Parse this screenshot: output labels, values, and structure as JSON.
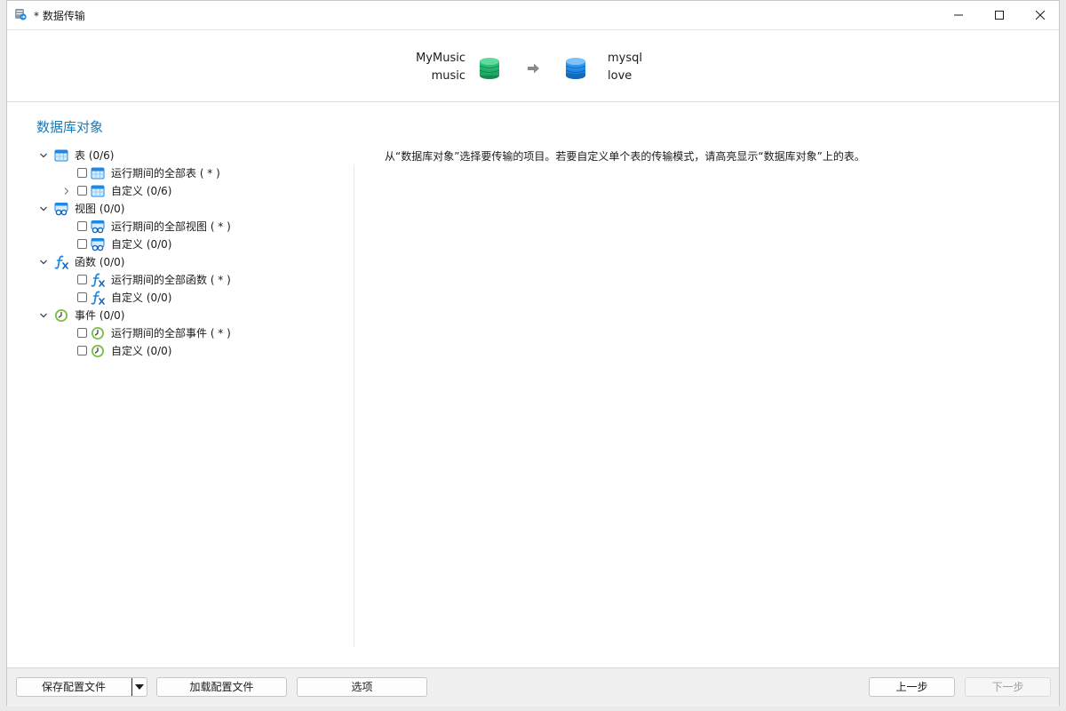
{
  "window": {
    "title": "* 数据传输"
  },
  "header": {
    "source": {
      "connection": "MyMusic",
      "database": "music"
    },
    "target": {
      "connection": "mysql",
      "database": "love"
    }
  },
  "section_title": "数据库对象",
  "tree": {
    "tables": {
      "label": "表 (0/6)",
      "all": "运行期间的全部表 ( * )",
      "custom": "自定义 (0/6)"
    },
    "views": {
      "label": "视图 (0/0)",
      "all": "运行期间的全部视图 ( * )",
      "custom": "自定义 (0/0)"
    },
    "functions": {
      "label": "函数 (0/0)",
      "all": "运行期间的全部函数 ( * )",
      "custom": "自定义 (0/0)"
    },
    "events": {
      "label": "事件 (0/0)",
      "all": "运行期间的全部事件 ( * )",
      "custom": "自定义 (0/0)"
    }
  },
  "hint": "从“数据库对象”选择要传输的项目。若要自定义单个表的传输模式，请高亮显示“数据库对象”上的表。",
  "footer": {
    "save_profile": "保存配置文件",
    "load_profile": "加载配置文件",
    "options": "选项",
    "back": "上一步",
    "next": "下一步"
  },
  "colors": {
    "accent": "#1a7ab5",
    "source_db": "#1fa463",
    "target_db": "#1e88e5"
  }
}
